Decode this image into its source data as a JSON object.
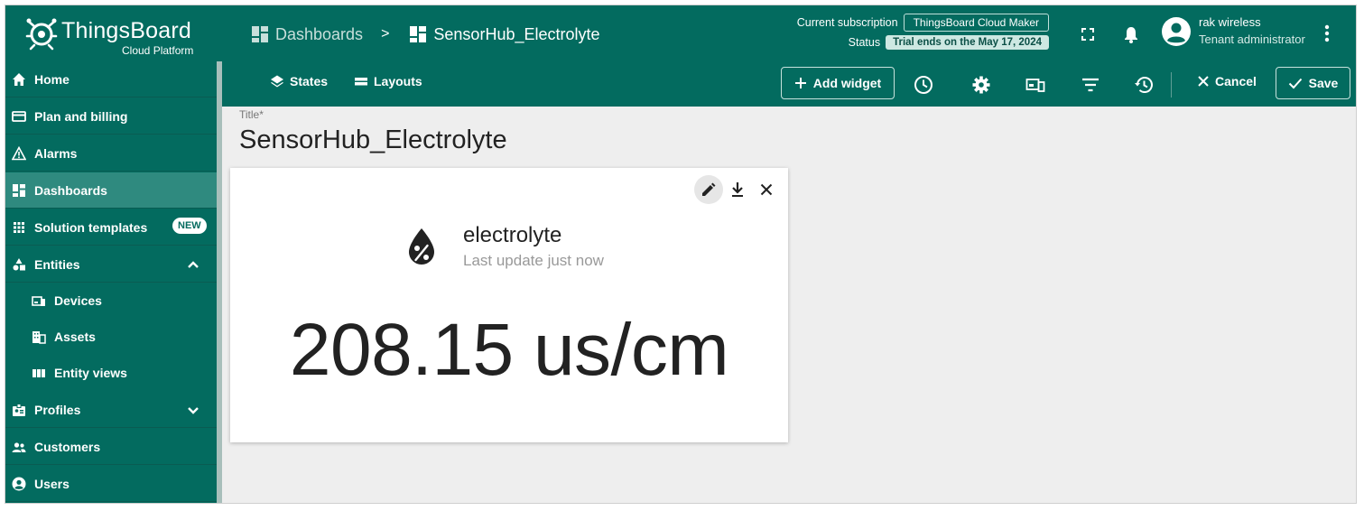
{
  "header": {
    "logo_name": "ThingsBoard",
    "logo_sub": "Cloud Platform",
    "breadcrumb_parent": "Dashboards",
    "breadcrumb_separator": ">",
    "breadcrumb_current": "SensorHub_Electrolyte",
    "subscription_label": "Current subscription",
    "subscription_value": "ThingsBoard Cloud Maker",
    "status_label": "Status",
    "status_value": "Trial ends on the May 17, 2024",
    "user_name": "rak wireless",
    "user_role": "Tenant administrator",
    "icons": [
      "fullscreen-icon",
      "notifications-icon",
      "account-icon",
      "more-vert-icon"
    ]
  },
  "sidebar": {
    "items": [
      {
        "label": "Home",
        "icon": "home-icon"
      },
      {
        "label": "Plan and billing",
        "icon": "credit-card-icon"
      },
      {
        "label": "Alarms",
        "icon": "warning-icon"
      },
      {
        "label": "Dashboards",
        "icon": "dashboard-icon",
        "active": true
      },
      {
        "label": "Solution templates",
        "icon": "apps-icon",
        "badge": "NEW"
      },
      {
        "label": "Entities",
        "icon": "category-icon",
        "expanded": true
      },
      {
        "label": "Devices",
        "icon": "devices-icon",
        "sub": true
      },
      {
        "label": "Assets",
        "icon": "domain-icon",
        "sub": true
      },
      {
        "label": "Entity views",
        "icon": "view-quilt-icon",
        "sub": true
      },
      {
        "label": "Profiles",
        "icon": "badge-icon",
        "expanded": false
      },
      {
        "label": "Customers",
        "icon": "supervisor-icon"
      },
      {
        "label": "Users",
        "icon": "account-circle-icon"
      }
    ]
  },
  "toolbar": {
    "states_label": "States",
    "layouts_label": "Layouts",
    "add_widget_label": "Add widget",
    "cancel_label": "Cancel",
    "save_label": "Save",
    "icons": [
      "schedule-icon",
      "settings-icon",
      "devices-icon",
      "filter-list-icon",
      "history-icon"
    ]
  },
  "content": {
    "title_label": "Title*",
    "title_value": "SensorHub_Electrolyte"
  },
  "widget": {
    "label": "electrolyte",
    "subtitle": "Last update just now",
    "value": "208.15 us/cm",
    "actions": [
      "edit-icon",
      "download-icon",
      "close-icon"
    ]
  },
  "colors": {
    "primary": "#036b5f",
    "active_item": "#2f8a7f",
    "background": "#eeeeee"
  }
}
